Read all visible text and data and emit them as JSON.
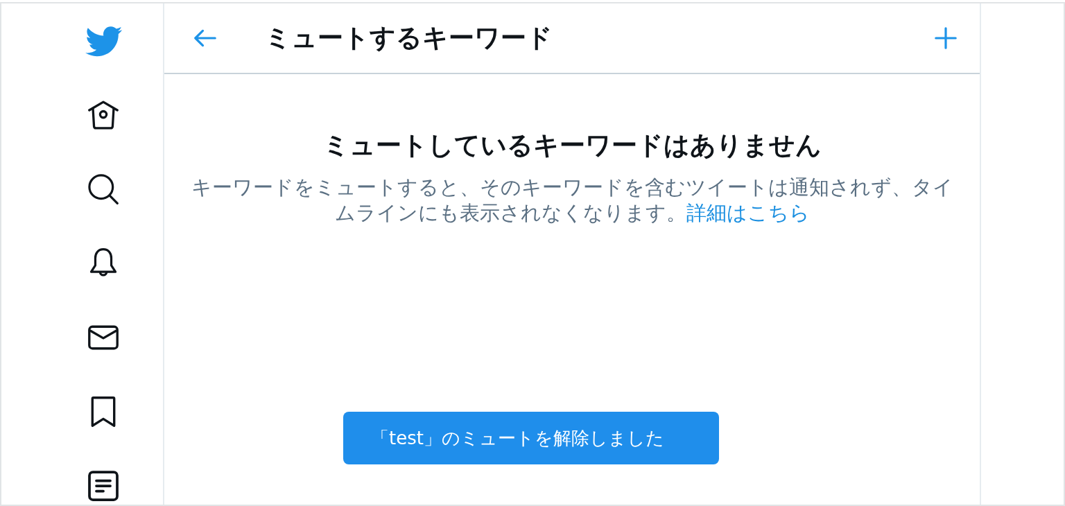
{
  "header": {
    "title": "ミュートするキーワード"
  },
  "empty_state": {
    "heading": "ミュートしているキーワードはありません",
    "description": "キーワードをミュートすると、そのキーワードを含むツイートは通知されず、タイムラインにも表示されなくなります。",
    "link": "詳細はこちら"
  },
  "toast": {
    "message": "「test」のミュートを解除しました"
  }
}
